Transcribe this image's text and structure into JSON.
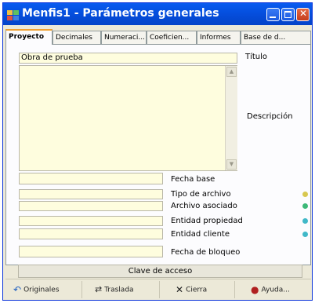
{
  "window": {
    "title": "Menfis1 - Parámetros generales"
  },
  "tabs": [
    {
      "label": "Proyecto",
      "active": true
    },
    {
      "label": "Decimales",
      "active": false
    },
    {
      "label": "Numeraci...",
      "active": false
    },
    {
      "label": "Coeficien...",
      "active": false
    },
    {
      "label": "Informes",
      "active": false
    },
    {
      "label": "Base de d...",
      "active": false
    }
  ],
  "form": {
    "titulo": {
      "label": "Título",
      "value": "Obra de prueba"
    },
    "descripcion": {
      "label": "Descripción",
      "value": ""
    },
    "fecha_base": {
      "label": "Fecha base",
      "value": ""
    },
    "tipo_archivo": {
      "label": "Tipo de archivo",
      "value": ""
    },
    "archivo_asociado": {
      "label": "Archivo asociado",
      "value": ""
    },
    "entidad_propiedad": {
      "label": "Entidad propiedad",
      "value": ""
    },
    "entidad_cliente": {
      "label": "Entidad cliente",
      "value": ""
    },
    "fecha_bloqueo": {
      "label": "Fecha de bloqueo",
      "value": ""
    },
    "clave_acceso": {
      "label": "Clave de acceso"
    }
  },
  "buttons": {
    "originales": "Originales",
    "traslada": "Traslada",
    "cierra": "Cierra",
    "ayuda": "Ayuda..."
  },
  "colors": {
    "titlebar": "#0550e0",
    "field_bg": "#fefdde",
    "tab_active_accent": "#f0a030",
    "dot_yellow": "#d8c850",
    "dot_green": "#3cb878",
    "dot_teal": "#40b8c8"
  }
}
